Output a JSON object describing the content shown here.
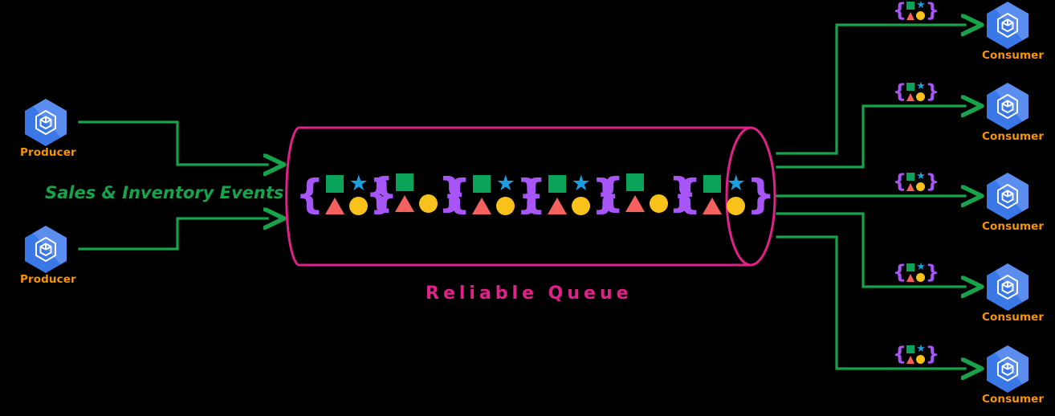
{
  "diagram": {
    "title": "Reliable Queue fan-out messaging diagram",
    "background": "#000000"
  },
  "colors": {
    "producer_label": "#F79400",
    "consumer_label": "#F79400",
    "queue_outline": "#E0218A",
    "queue_label": "#E0218A",
    "arrow": "#16A34A",
    "flow_label": "#16A34A",
    "brace": "#A855F7",
    "shape_square": "#0BA259",
    "shape_star": "#1C9FE0",
    "shape_triangle": "#F4615F",
    "shape_circle": "#F9C21B",
    "node_hex_light": "#5B8DEF",
    "node_hex_dark": "#3B78E7"
  },
  "producers": [
    {
      "label": "Producer",
      "icon": "cube-hexagon-icon"
    },
    {
      "label": "Producer",
      "icon": "cube-hexagon-icon"
    }
  ],
  "flow_label": "Sales & Inventory Events",
  "queue": {
    "label": "Reliable Queue",
    "messages": [
      {
        "square": true,
        "star": true,
        "triangle": true,
        "circle": true
      },
      {
        "square": true,
        "star": false,
        "triangle": true,
        "circle": true
      },
      {
        "square": true,
        "star": true,
        "triangle": true,
        "circle": true
      },
      {
        "square": true,
        "star": true,
        "triangle": true,
        "circle": true
      },
      {
        "square": true,
        "star": false,
        "triangle": true,
        "circle": true
      },
      {
        "square": true,
        "star": true,
        "triangle": true,
        "circle": true
      }
    ]
  },
  "consumers": [
    {
      "label": "Consumer",
      "icon": "cube-hexagon-icon",
      "badge": {
        "square": true,
        "star": true,
        "triangle": true,
        "circle": true
      }
    },
    {
      "label": "Consumer",
      "icon": "cube-hexagon-icon",
      "badge": {
        "square": true,
        "star": true,
        "triangle": true,
        "circle": true
      }
    },
    {
      "label": "Consumer",
      "icon": "cube-hexagon-icon",
      "badge": {
        "square": true,
        "star": true,
        "triangle": true,
        "circle": true
      }
    },
    {
      "label": "Consumer",
      "icon": "cube-hexagon-icon",
      "badge": {
        "square": true,
        "star": true,
        "triangle": true,
        "circle": true
      }
    },
    {
      "label": "Consumer",
      "icon": "cube-hexagon-icon",
      "badge": {
        "square": true,
        "star": true,
        "triangle": true,
        "circle": true
      }
    }
  ],
  "glyphs": {
    "brace_open": "{",
    "brace_close": "}",
    "star": "★"
  }
}
